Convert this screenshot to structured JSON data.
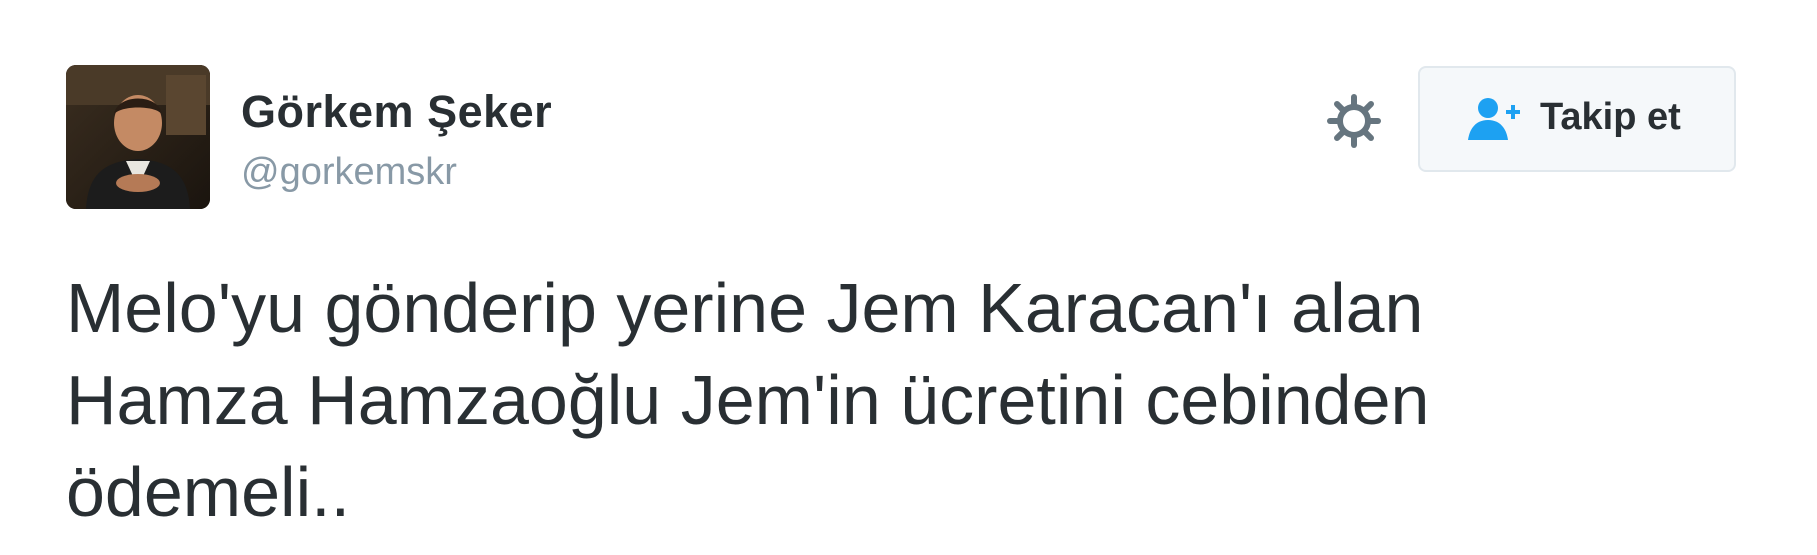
{
  "user": {
    "display_name": "Görkem Şeker",
    "handle": "@gorkemskr",
    "avatar_icon": "avatar-photo"
  },
  "actions": {
    "settings_icon": "gear-icon",
    "follow_icon": "user-plus-icon",
    "follow_label": "Takip et"
  },
  "tweet": {
    "lines": [
      "Melo'yu gönderip yerine Jem Karacan'ı alan",
      "Hamza Hamzaoğlu Jem'in ücretini cebinden",
      "ödemeli.."
    ]
  },
  "colors": {
    "name": "#292f33",
    "handle": "#8899a6",
    "gear": "#66757f",
    "follow_icon": "#1da1f2",
    "button_bg": "#f5f8fa",
    "button_border": "#e1e8ed"
  }
}
